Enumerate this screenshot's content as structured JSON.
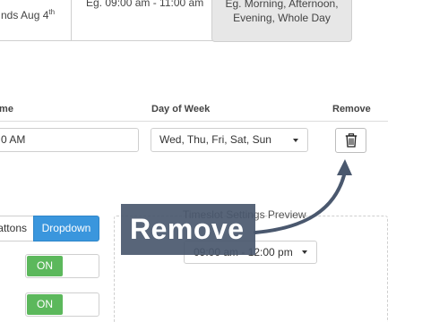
{
  "top_boxes": {
    "dates_line1": "",
    "dates_line2": "nds Aug 4",
    "dates_sup": "th",
    "times_example": "Eg. 09:00 am - 11:00 am",
    "periods_line1": "Eg. Morning, Afternoon,",
    "periods_line2": "Evening, Whole Day"
  },
  "table": {
    "headers": {
      "time": "ime",
      "day_of_week": "Day of Week",
      "remove": "Remove"
    },
    "row": {
      "time_value": "0 AM",
      "days_value": "Wed, Thu, Fri, Sat, Sun"
    }
  },
  "display_toggle": {
    "buttons_label": "attons",
    "dropdown_label": "Dropdown",
    "selected": "Dropdown"
  },
  "switches": [
    {
      "label": "ON",
      "state": "on"
    },
    {
      "label": "ON",
      "state": "on"
    }
  ],
  "preview": {
    "title": "Timeslot Settings Preview",
    "select_value": "09:00 am - 12:00 pm"
  },
  "annotation": {
    "callout_text": "Remove"
  },
  "colors": {
    "accent_blue": "#3a96dd",
    "switch_green": "#5cb85c",
    "callout_bg": "#4a586e",
    "active_box_bg": "#e7e7e7"
  },
  "icons": {
    "remove": "trash-icon",
    "dropdown": "caret-down-icon"
  }
}
